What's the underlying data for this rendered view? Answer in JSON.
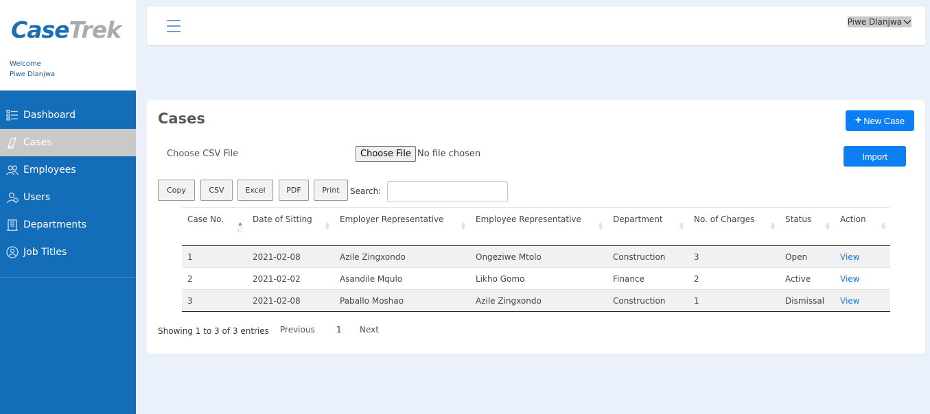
{
  "brand": {
    "logo_part1": "Ca",
    "logo_part2": "se",
    "logo_part3": "Trek",
    "welcome": "Welcome",
    "user_name": "Piwe Dlanjwa"
  },
  "sidebar": {
    "items": [
      {
        "label": "Dashboard",
        "icon": "dashboard-icon"
      },
      {
        "label": "Cases",
        "icon": "cases-icon"
      },
      {
        "label": "Employees",
        "icon": "employees-icon"
      },
      {
        "label": "Users",
        "icon": "users-icon"
      },
      {
        "label": "Departments",
        "icon": "departments-icon"
      },
      {
        "label": "Job Titles",
        "icon": "job-titles-icon"
      }
    ],
    "active_index": 1
  },
  "header": {
    "user_menu": "Piwe Dlanjwa"
  },
  "cases": {
    "title": "Cases",
    "new_case": "New Case",
    "import": "Import",
    "csv_label": "Choose CSV File",
    "file_button": "Choose File",
    "file_status": "No file chosen",
    "export_buttons": [
      "Copy",
      "CSV",
      "Excel",
      "PDF",
      "Print"
    ],
    "search_label": "Search:",
    "search_value": "",
    "columns": [
      "Case No.",
      "Date of Sitting",
      "Employer Representative",
      "Employee Representative",
      "Department",
      "No. of Charges",
      "Status",
      "Action"
    ],
    "rows": [
      {
        "case_no": "1",
        "date": "2021-02-08",
        "employer_rep": "Azile Zingxondo",
        "employee_rep": "Ongeziwe Mtolo",
        "department": "Construction",
        "charges": "3",
        "status": "Open",
        "action": "View"
      },
      {
        "case_no": "2",
        "date": "2021-02-02",
        "employer_rep": "Asandile Mqulo",
        "employee_rep": "Likho Gomo",
        "department": "Finance",
        "charges": "2",
        "status": "Active",
        "action": "View"
      },
      {
        "case_no": "3",
        "date": "2021-02-08",
        "employer_rep": "Paballo Moshao",
        "employee_rep": "Azile Zingxondo",
        "department": "Construction",
        "charges": "1",
        "status": "Dismissal",
        "action": "View"
      }
    ],
    "info": "Showing 1 to 3 of 3 entries",
    "previous": "Previous",
    "page": "1",
    "next": "Next"
  },
  "colors": {
    "sidebar": "#136db8",
    "primary": "#0d7ff5",
    "background": "#eaf1fa",
    "active_item": "#c9c9c9"
  }
}
